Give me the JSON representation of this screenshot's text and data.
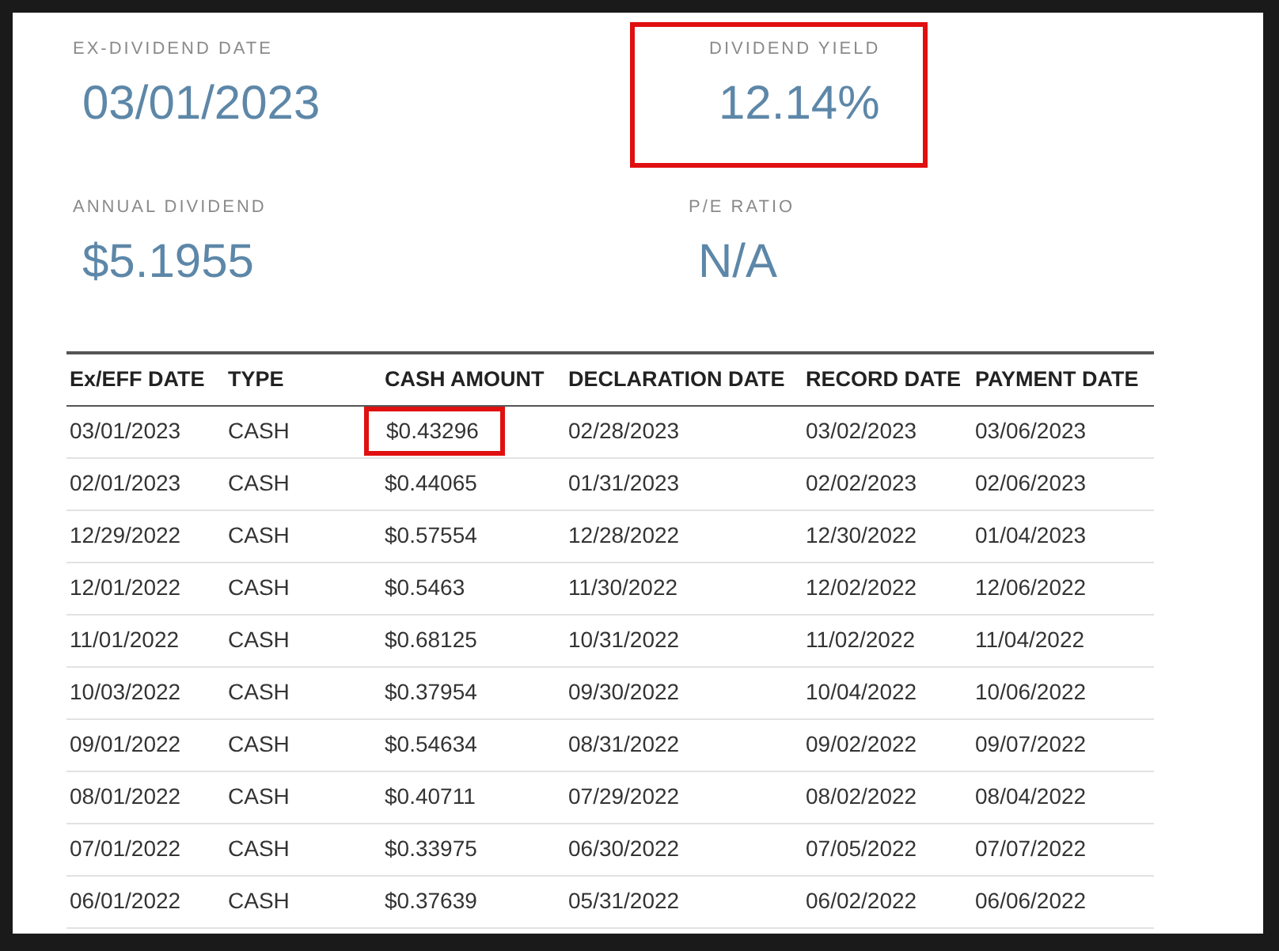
{
  "stats": [
    {
      "label": "EX-DIVIDEND DATE",
      "value": "03/01/2023",
      "highlighted": false
    },
    {
      "label": "DIVIDEND YIELD",
      "value": "12.14%",
      "highlighted": true
    },
    {
      "label": "ANNUAL DIVIDEND",
      "value": "$5.1955",
      "highlighted": false
    },
    {
      "label": "P/E RATIO",
      "value": "N/A",
      "highlighted": false
    }
  ],
  "table": {
    "columns": [
      "Ex/EFF DATE",
      "TYPE",
      "CASH AMOUNT",
      "DECLARATION DATE",
      "RECORD DATE",
      "PAYMENT DATE"
    ],
    "rows": [
      {
        "cells": [
          "03/01/2023",
          "CASH",
          "$0.43296",
          "02/28/2023",
          "03/02/2023",
          "03/06/2023"
        ],
        "highlighted": [
          false,
          false,
          true,
          false,
          false,
          false
        ]
      },
      {
        "cells": [
          "02/01/2023",
          "CASH",
          "$0.44065",
          "01/31/2023",
          "02/02/2023",
          "02/06/2023"
        ],
        "highlighted": [
          false,
          false,
          false,
          false,
          false,
          false
        ]
      },
      {
        "cells": [
          "12/29/2022",
          "CASH",
          "$0.57554",
          "12/28/2022",
          "12/30/2022",
          "01/04/2023"
        ],
        "highlighted": [
          false,
          false,
          false,
          false,
          false,
          false
        ]
      },
      {
        "cells": [
          "12/01/2022",
          "CASH",
          "$0.5463",
          "11/30/2022",
          "12/02/2022",
          "12/06/2022"
        ],
        "highlighted": [
          false,
          false,
          false,
          false,
          false,
          false
        ]
      },
      {
        "cells": [
          "11/01/2022",
          "CASH",
          "$0.68125",
          "10/31/2022",
          "11/02/2022",
          "11/04/2022"
        ],
        "highlighted": [
          false,
          false,
          false,
          false,
          false,
          false
        ]
      },
      {
        "cells": [
          "10/03/2022",
          "CASH",
          "$0.37954",
          "09/30/2022",
          "10/04/2022",
          "10/06/2022"
        ],
        "highlighted": [
          false,
          false,
          false,
          false,
          false,
          false
        ]
      },
      {
        "cells": [
          "09/01/2022",
          "CASH",
          "$0.54634",
          "08/31/2022",
          "09/02/2022",
          "09/07/2022"
        ],
        "highlighted": [
          false,
          false,
          false,
          false,
          false,
          false
        ]
      },
      {
        "cells": [
          "08/01/2022",
          "CASH",
          "$0.40711",
          "07/29/2022",
          "08/02/2022",
          "08/04/2022"
        ],
        "highlighted": [
          false,
          false,
          false,
          false,
          false,
          false
        ]
      },
      {
        "cells": [
          "07/01/2022",
          "CASH",
          "$0.33975",
          "06/30/2022",
          "07/05/2022",
          "07/07/2022"
        ],
        "highlighted": [
          false,
          false,
          false,
          false,
          false,
          false
        ]
      },
      {
        "cells": [
          "06/01/2022",
          "CASH",
          "$0.37639",
          "05/31/2022",
          "06/02/2022",
          "06/06/2022"
        ],
        "highlighted": [
          false,
          false,
          false,
          false,
          false,
          false
        ]
      }
    ]
  }
}
